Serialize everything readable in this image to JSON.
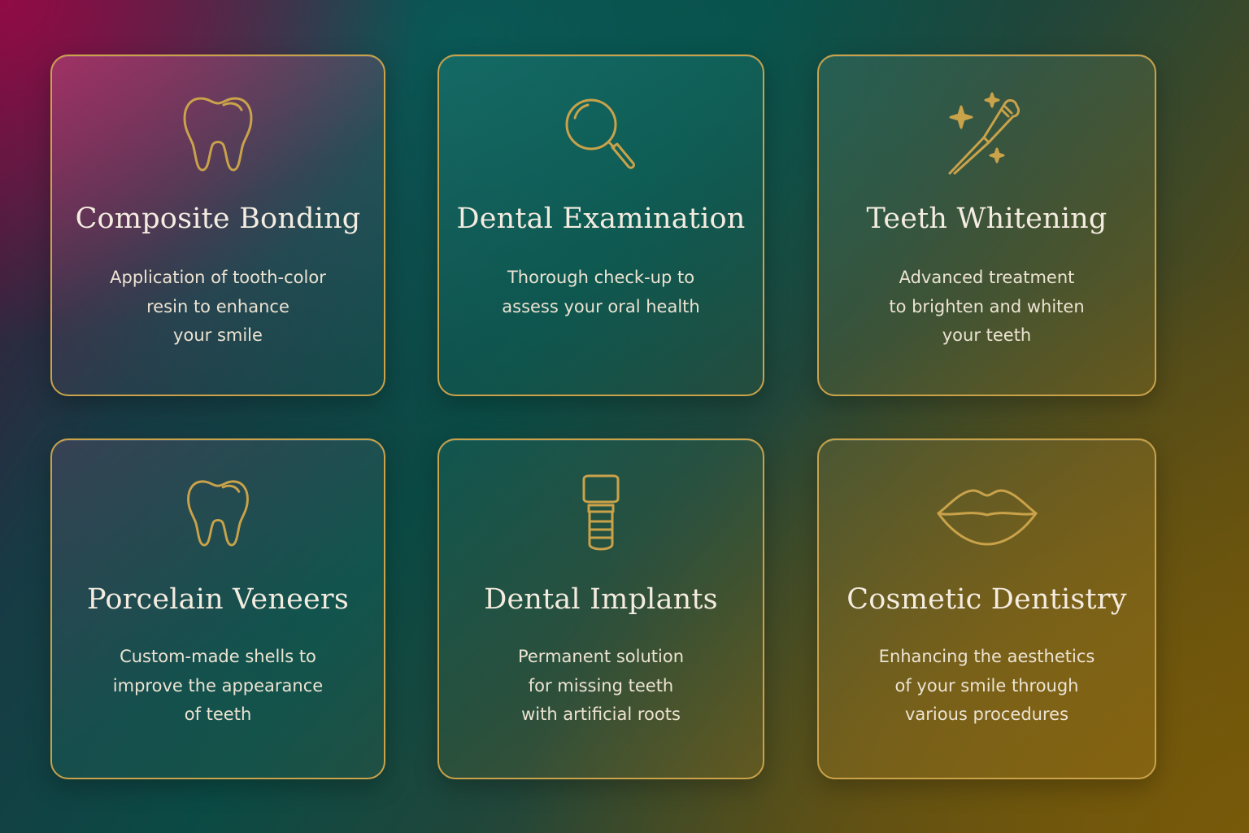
{
  "accent_color": "#c9a24a",
  "services": [
    {
      "title": "Composite Bonding",
      "icon": "tooth-icon",
      "lines": [
        "Application of tooth-color",
        "resin to enhance",
        "your smile"
      ]
    },
    {
      "title": "Dental Examination",
      "icon": "magnifier-icon",
      "lines": [
        "Thorough check-up to",
        "assess your oral health"
      ]
    },
    {
      "title": "Teeth Whitening",
      "icon": "toothbrush-sparkle-icon",
      "lines": [
        "Advanced treatment",
        "to brighten and whiten",
        "your teeth"
      ]
    },
    {
      "title": "Porcelain Veneers",
      "icon": "tooth-icon",
      "lines": [
        "Custom-made shells to",
        "improve the appearance",
        "of teeth"
      ]
    },
    {
      "title": "Dental Implants",
      "icon": "implant-icon",
      "lines": [
        "Permanent solution",
        "for missing teeth",
        "with artificial roots"
      ]
    },
    {
      "title": "Cosmetic Dentistry",
      "icon": "lips-icon",
      "lines": [
        "Enhancing the aesthetics",
        "of your smile through",
        "various procedures"
      ]
    }
  ]
}
